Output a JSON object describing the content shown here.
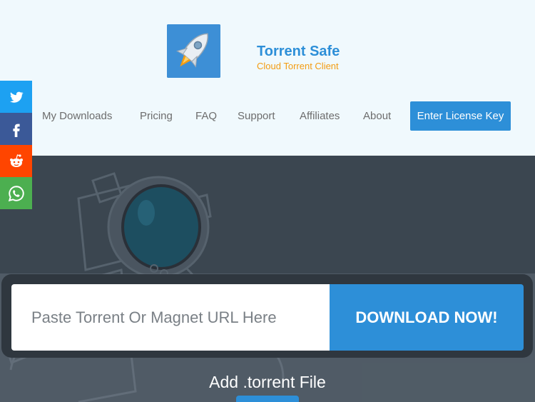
{
  "brand": {
    "name": "Torrent Safe",
    "tagline": "Cloud Torrent Client",
    "colors": {
      "primary": "#2d8fd8",
      "accent": "#f39c12",
      "hero_bg": "#3b4650"
    }
  },
  "nav": {
    "items": [
      {
        "label": "My Downloads"
      },
      {
        "label": "Pricing"
      },
      {
        "label": "FAQ"
      },
      {
        "label": "Support"
      },
      {
        "label": "Affiliates"
      },
      {
        "label": "About"
      }
    ],
    "license_button": "Enter License Key"
  },
  "share": [
    {
      "icon": "twitter-icon",
      "color": "#1da1f2"
    },
    {
      "icon": "facebook-icon",
      "color": "#3b5998"
    },
    {
      "icon": "reddit-icon",
      "color": "#ff4500"
    },
    {
      "icon": "whatsapp-icon",
      "color": "#4caf50"
    }
  ],
  "hero": {
    "url_placeholder": "Paste Torrent Or Magnet URL Here",
    "download_button": "DOWNLOAD NOW!",
    "add_torrent_label": "Add .torrent File"
  }
}
